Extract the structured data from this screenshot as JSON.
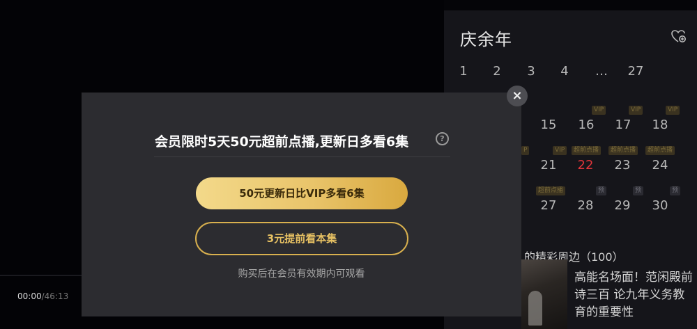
{
  "player": {
    "time_current": "00:00",
    "time_total": "/46:13"
  },
  "panel": {
    "title": "庆余年",
    "fav_icon": "heart-plus-icon",
    "episodes_row1": [
      "1",
      "2",
      "3",
      "4",
      "…",
      "27"
    ],
    "episodes_row2": [
      "15",
      "16",
      "17",
      "18"
    ],
    "episodes_row3": [
      "21",
      "22",
      "23",
      "24"
    ],
    "episodes_row4": [
      "27",
      "28",
      "29",
      "30"
    ],
    "current_episode": "22",
    "badges_row2": [
      "VIP",
      "VIP",
      "VIP"
    ],
    "badges_row3": [
      "P",
      "VIP",
      "超前点播",
      "超前点播",
      "超前点播"
    ],
    "badges_row4": [
      "超前点播",
      "预",
      "预",
      "预"
    ],
    "section_title": "的精彩周边（100）",
    "related_title": "高能名场面！范闲殿前诗三百 论九年义务教育的重要性"
  },
  "modal": {
    "title": "会员限时5天50元超前点播,更新日多看6集",
    "help_icon": "question-circle-icon",
    "help_glyph": "?",
    "primary_button": "50元更新日比VIP多看6集",
    "secondary_button": "3元提前看本集",
    "note": "购买后在会员有效期内可观看",
    "close_glyph": "×",
    "close_icon": "close-icon"
  },
  "colors": {
    "accent_gold": "#e9c46a",
    "current_episode": "#e0353a",
    "modal_bg": "#2c2c30"
  }
}
